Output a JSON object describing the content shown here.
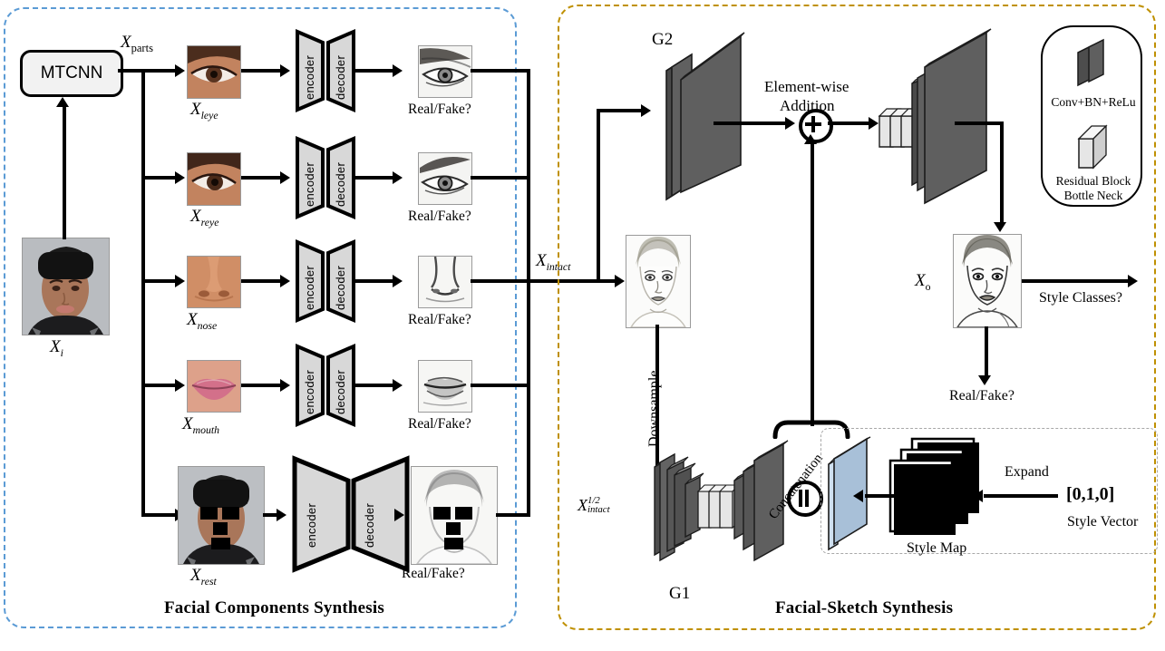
{
  "panels": {
    "left": {
      "title": "Facial Components Synthesis",
      "border_color": "#5b9bd5"
    },
    "right": {
      "title": "Facial-Sketch  Synthesis",
      "border_color": "#bf9000"
    }
  },
  "left_panel": {
    "detector_label": "MTCNN",
    "input_label_x": "X",
    "input_label_sub": "i",
    "parts_label_x": "X",
    "parts_label_sub": "parts",
    "encoder_label": "encoder",
    "decoder_label": "decoder",
    "branches": [
      {
        "name": "left-eye",
        "part_x": "X",
        "part_sub": "leye",
        "discriminator": "Real/Fake?"
      },
      {
        "name": "right-eye",
        "part_x": "X",
        "part_sub": "reye",
        "discriminator": "Real/Fake?"
      },
      {
        "name": "nose",
        "part_x": "X",
        "part_sub": "nose",
        "discriminator": "Real/Fake?"
      },
      {
        "name": "mouth",
        "part_x": "X",
        "part_sub": "mouth",
        "discriminator": "Real/Fake?"
      },
      {
        "name": "rest",
        "part_x": "X",
        "part_sub": "rest",
        "discriminator": "Real/Fake?"
      }
    ]
  },
  "right_panel": {
    "g2_label": "G2",
    "g1_label": "G1",
    "intact_x": "X",
    "intact_sub": "intact",
    "intact_half_x": "X",
    "intact_half_sup": "1/2",
    "intact_half_sub": "intact",
    "downsample_label": "Downsample",
    "elementwise_line1": "Element-wise",
    "elementwise_line2": "Addition",
    "concatenation_label": "Concatenation",
    "output_x": "X",
    "output_sub": "o",
    "style_classes_label": "Style Classes?",
    "real_fake_label": "Real/Fake?",
    "style_map_label": "Style Map",
    "style_vector_label": "Style Vector",
    "style_vector_value": "[0,1,0]",
    "expand_label": "Expand",
    "add_symbol": "⊕",
    "concat_symbol": "‖"
  },
  "legend": {
    "items": [
      {
        "name": "conv-block",
        "caption": "Conv+BN+ReLu",
        "color": "#5f5f5f"
      },
      {
        "name": "residual-block",
        "caption_line1": "Residual Block",
        "caption_line2": "Bottle Neck",
        "color": "#e3e3e3"
      }
    ]
  },
  "colors": {
    "conv_face": "#5f5f5f",
    "conv_side": "#3f3f3f",
    "conv_top": "#7b7b7b",
    "res_face": "#e6e6e6",
    "res_side": "#b8b8b8",
    "res_top": "#f4f4f4",
    "style_face": "#a8c0d8",
    "style_side": "#cfe0f0",
    "hourglass_fill": "#d8d8d8",
    "left_border": "#5b9bd5",
    "right_border": "#bf9000",
    "black": "#000000"
  }
}
